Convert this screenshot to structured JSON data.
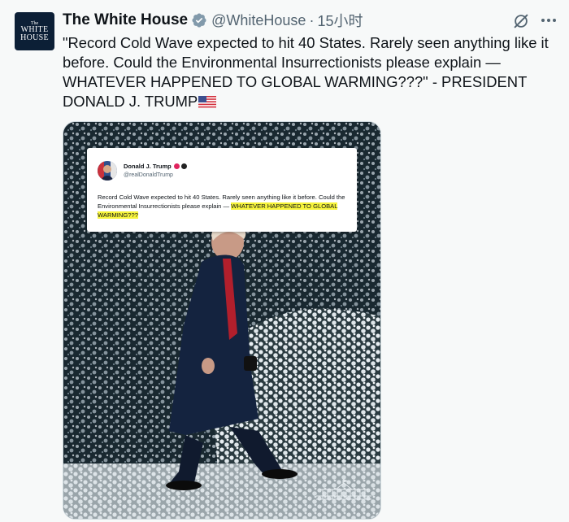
{
  "account": {
    "avatar_line1": "The",
    "avatar_line2": "WHITE",
    "avatar_line3": "HOUSE",
    "name": "The White House",
    "handle": "@WhiteHouse",
    "separator": "·",
    "time": "15小时"
  },
  "tweet": {
    "text": "\"Record Cold Wave expected to hit 40 States. Rarely seen anything like it before. Could the Environmental Insurrectionists please explain — WHATEVER HAPPENED TO GLOBAL WARMING???\" - PRESIDENT DONALD J. TRUMP"
  },
  "embedded_post": {
    "name": "Donald J. Trump",
    "handle": "@realDonaldTrump",
    "text_plain": "Record Cold Wave expected to hit 40 States. Rarely seen anything like it before. Could the Environmental Insurrectionists please explain —",
    "text_highlight": "WHATEVER HAPPENED TO GLOBAL WARMING???"
  },
  "icons": {
    "verified": "verified-badge-icon",
    "grok": "grok-icon",
    "more": "more-icon",
    "flag": "us-flag-icon"
  },
  "colors": {
    "verified_badge": "#829aab",
    "secondary_text": "#536471",
    "highlight": "#f7f43c",
    "avatar_bg": "#0c1f36"
  }
}
